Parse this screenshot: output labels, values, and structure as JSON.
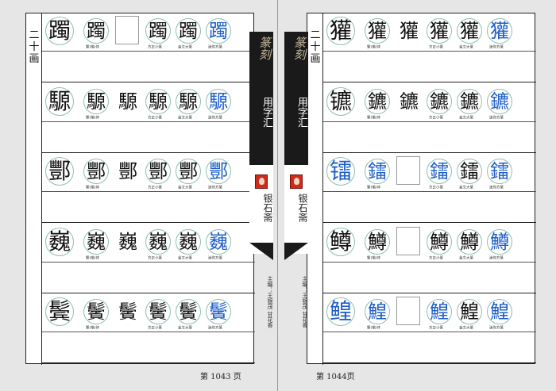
{
  "section_label": "二十画",
  "spine": {
    "title_seal": "篆刻",
    "title_regular": "用字汇",
    "publisher": "银石斋",
    "editors": "主编：王银茂 甘花香"
  },
  "captions": {
    "traditional": "繁(楷)体",
    "fangzheng": "方正小篆",
    "jinwen": "金文大篆",
    "diy": "迷你方篆"
  },
  "left_page": {
    "page_number": "第 1043 页",
    "rows": [
      {
        "head": "躅",
        "trad": "躅",
        "seal": "",
        "f1": "躅",
        "f2": "躅",
        "f3": "躅"
      },
      {
        "head": "騵",
        "trad": "騵",
        "seal": "騵",
        "f1": "騵",
        "f2": "騵",
        "f3": "騵"
      },
      {
        "head": "酆",
        "trad": "酆",
        "seal": "酆",
        "f1": "酆",
        "f2": "酆",
        "f3": "酆"
      },
      {
        "head": "巍",
        "trad": "巍",
        "seal": "巍",
        "f1": "巍",
        "f2": "巍",
        "f3": "巍"
      },
      {
        "head": "鬓",
        "trad": "鬢",
        "seal": "鬢",
        "f1": "鬢",
        "f2": "鬢",
        "f3": "鬢"
      }
    ]
  },
  "right_page": {
    "page_number": "第 1044页",
    "rows": [
      {
        "head": "獾",
        "trad": "獾",
        "seal": "獾",
        "f1": "獾",
        "f2": "獾",
        "f3": "獾"
      },
      {
        "head": "镳",
        "trad": "鑣",
        "seal": "鑣",
        "f1": "鑣",
        "f2": "鑣",
        "f3": "鑣"
      },
      {
        "head": "镭",
        "trad": "鐳",
        "seal": "",
        "f1": "鐳",
        "f2": "鐳",
        "f3": "鐳"
      },
      {
        "head": "鳟",
        "trad": "鱒",
        "seal": "",
        "f1": "鱒",
        "f2": "鱒",
        "f3": "鱒"
      },
      {
        "head": "鳇",
        "trad": "鰉",
        "seal": "",
        "f1": "鰉",
        "f2": "鰉",
        "f3": "鰉"
      }
    ]
  },
  "colors": {
    "blue_glyph": "#1f5fc8",
    "circle_border": "#8fbfae",
    "spine": "#1a1a1a"
  }
}
